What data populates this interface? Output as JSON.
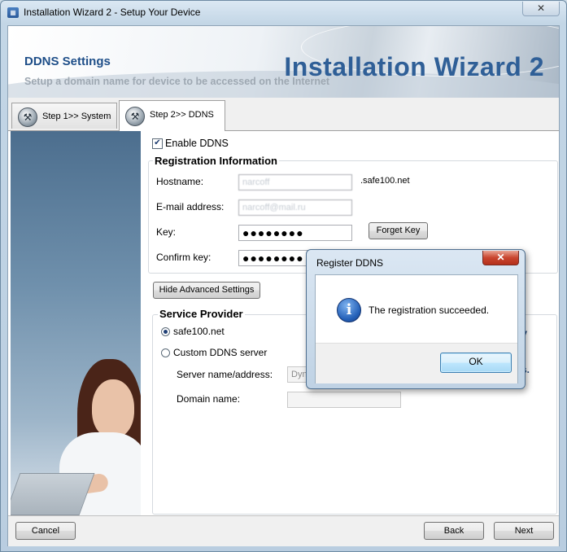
{
  "window": {
    "title": "Installation Wizard 2 - Setup Your Device",
    "close_glyph": "✕"
  },
  "banner": {
    "title": "DDNS Settings",
    "subtitle": "Setup a domain name for device to be accessed on the Internet",
    "brand": "Installation Wizard 2"
  },
  "tabs": [
    {
      "label": "Step 1>> System"
    },
    {
      "label": "Step 2>> DDNS"
    }
  ],
  "form": {
    "enable_ddns_label": "Enable DDNS",
    "enable_ddns_checked": true,
    "registration": {
      "title": "Registration Information",
      "hostname_label": "Hostname:",
      "hostname_value": "narcoff",
      "hostname_suffix": ".safe100.net",
      "email_label": "E-mail address:",
      "email_value": "narcoff@mail.ru",
      "key_label": "Key:",
      "key_value": "●●●●●●●●",
      "forget_key_label": "Forget Key",
      "confirm_key_label": "Confirm key:",
      "confirm_key_value": "●●●●●●●●"
    },
    "hide_advanced_label": "Hide Advanced Settings",
    "service_provider": {
      "title": "Service Provider",
      "option_safe100": "safe100.net",
      "option_custom": "Custom DDNS server",
      "selected": "safe100.net",
      "server_label": "Server name/address:",
      "server_value": "Dyn",
      "domain_label": "Domain name:",
      "domain_value": ""
    },
    "behind_text": [
      "ly",
      "o",
      "r",
      "s."
    ]
  },
  "footer": {
    "cancel_label": "Cancel",
    "back_label": "Back",
    "next_label": "Next"
  },
  "dialog": {
    "title": "Register DDNS",
    "close_glyph": "✕",
    "icon": "info-icon",
    "message": "The registration succeeded.",
    "ok_label": "OK"
  },
  "colors": {
    "brand_blue": "#2f5f97",
    "title_blue": "#1f4f89",
    "dialog_close_red": "#c9452f"
  }
}
